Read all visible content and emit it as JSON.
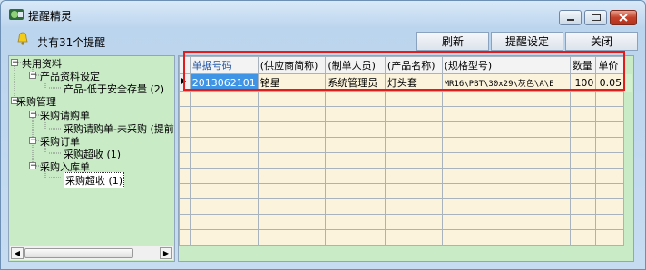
{
  "window": {
    "title": "提醒精灵"
  },
  "toolbar": {
    "reminder_count": "共有31个提醒",
    "refresh_label": "刷新",
    "settings_label": "提醒设定",
    "close_label": "关闭"
  },
  "tree": {
    "shared": "共用资料",
    "product_setting": "产品资料设定",
    "below_safety": "产品-低于安全存量 (2)",
    "purchase_mgmt": "采购管理",
    "purchase_request": "采购请购单",
    "request_unpurchased": "采购请购单-未采购 (提前",
    "purchase_order": "采购订单",
    "order_overrun": "采购超收 (1)",
    "purchase_inbound": "采购入库单",
    "inbound_overrun": "采购超收 (1)"
  },
  "grid": {
    "columns": [
      "单据号码",
      "(供应商简称)",
      "(制单人员)",
      "(产品名称)",
      "(规格型号)",
      "数量",
      "单价"
    ],
    "rows": [
      [
        "2013062101",
        "铭星",
        "系统管理员",
        "灯头套",
        "MR16\\PBT\\30x29\\灰色\\A\\E",
        "100",
        "0.05"
      ]
    ]
  }
}
